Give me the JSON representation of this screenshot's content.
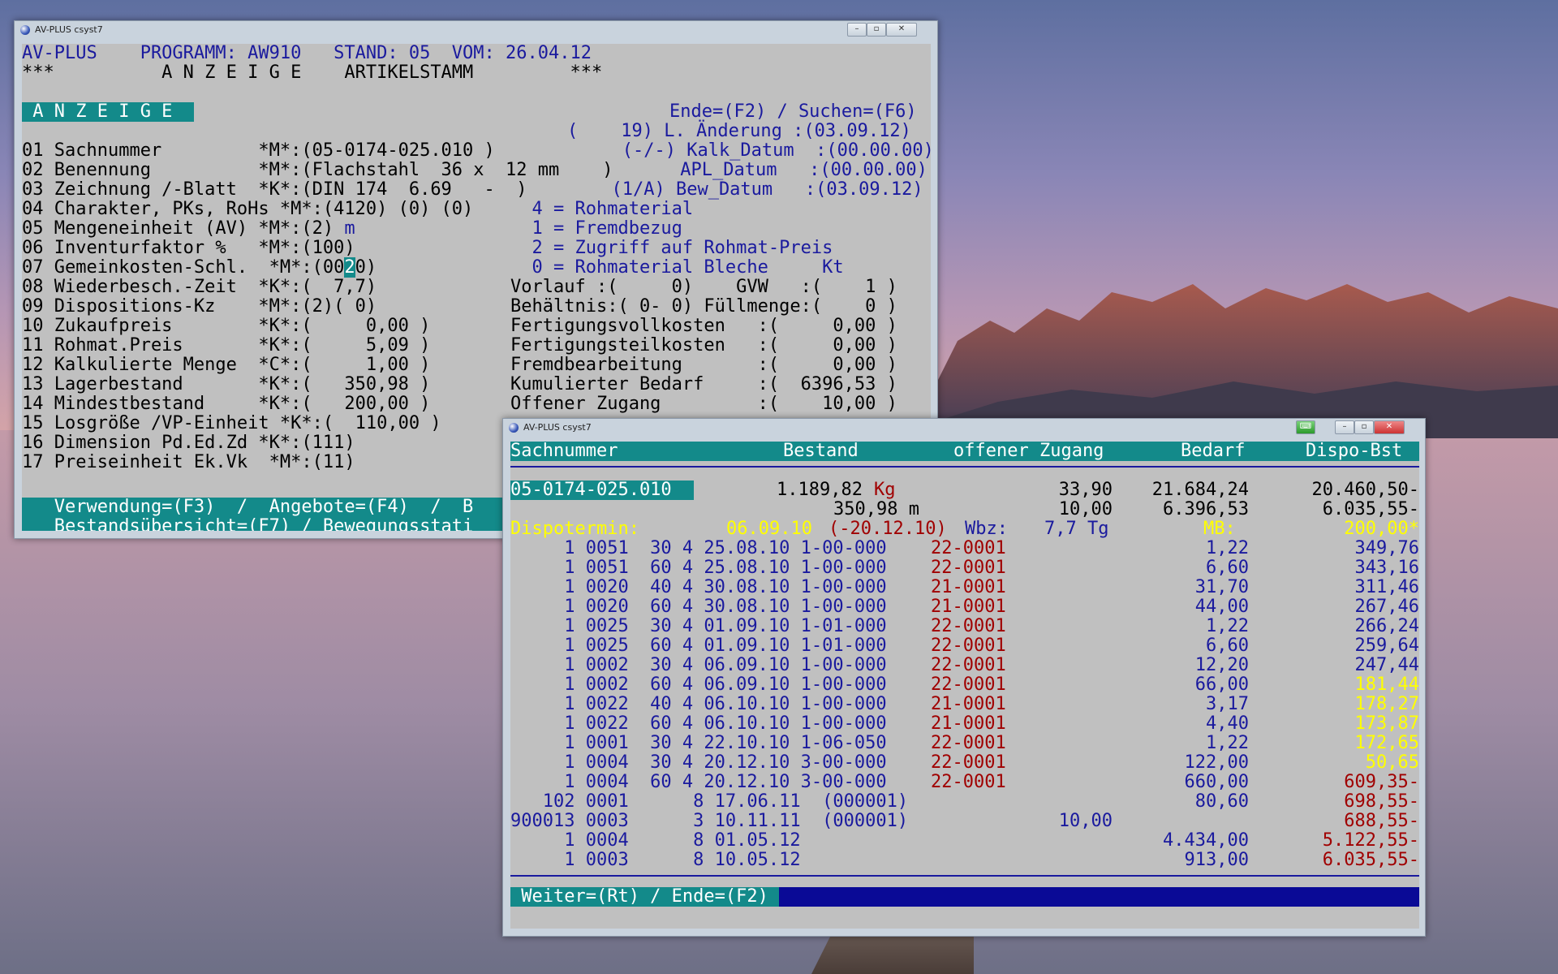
{
  "window1": {
    "title": "AV-PLUS csyst7",
    "header": [
      "AV-PLUS    PROGRAMM: AW910   STAND: 05  VOM: 26.04.12",
      "***          A N Z E I G E    ARTIKELSTAMM         ***"
    ],
    "mode_label": " A N Z E I G E ",
    "top_right": "Ende=(F2) / Suchen=(F6)",
    "lines": [
      {
        "left": "",
        "right": "(    19) L. Änderung :(03.09.12)"
      },
      {
        "left": "01 Sachnummer         *M*:(05-0174-025.010 )",
        "right": "   (-/-) Kalk_Datum  :(00.00.00)"
      },
      {
        "left": "02 Benennung          *M*:(Flachstahl  36 x  12 mm    )",
        "right": " APL_Datum   :(00.00.00)"
      },
      {
        "left": "03 Zeichnung /-Blatt  *K*:(DIN 174  6.69   -  )",
        "right": "  (1/A) Bew_Datum   :(03.09.12)"
      },
      {
        "left": "04 Charakter, PKs, RoHs *M*:(4120) (0) (0)",
        "right": "  4 = Rohmaterial"
      },
      {
        "left": "05 Mengeneinheit (AV) *M*:(2) ",
        "unit": "m",
        "right": "  1 = Fremdbezug"
      },
      {
        "left": "06 Inventurfaktor %   *M*:(100)",
        "right": "  2 = Zugriff auf Rohmat-Preis"
      },
      {
        "left": "07 Gemeinkosten-Schl.  *M*:(00",
        "cursor": "2",
        "left2": "0)",
        "right": "  0 = Rohmaterial Bleche     Kt"
      },
      {
        "left": "08 Wiederbesch.-Zeit  *K*:(  7,7)",
        "right": "Vorlauf :(     0)    GVW   :(    1 )"
      },
      {
        "left": "09 Dispositions-Kz    *M*:(2)( 0)",
        "right": "Behältnis:( 0- 0) Füllmenge:(    0 )"
      },
      {
        "left": "10 Zukaufpreis        *K*:(     0,00 )",
        "right": "Fertigungsvollkosten   :(     0,00 )"
      },
      {
        "left": "11 Rohmat.Preis       *K*:(     5,09 )",
        "right": "Fertigungsteilkosten   :(     0,00 )"
      },
      {
        "left": "12 Kalkulierte Menge  *C*:(     1,00 )",
        "right": "Fremdbearbeitung       :(     0,00 )"
      },
      {
        "left": "13 Lagerbestand       *K*:(   350,98 )",
        "right": "Kumulierter Bedarf     :(  6396,53 )"
      },
      {
        "left": "14 Mindestbestand     *K*:(   200,00 )",
        "right": "Offener Zugang         :(    10,00 )"
      },
      {
        "left": "15 Losgröße /VP-Einheit *K*:(  110,00 )",
        "right": ""
      },
      {
        "left": "16 Dimension Pd.Ed.Zd *K*:(111)",
        "right": ""
      },
      {
        "left": "17 Preiseinheit Ek.Vk  *M*:(11)",
        "right": ""
      }
    ],
    "footer1": "   Verwendung=(F3)  /  Angebote=(F4)  /  B",
    "footer2": "   Bestandsübersicht=(F7) / Bewegungsstati"
  },
  "window2": {
    "title": "AV-PLUS csyst7",
    "columns": [
      "Sachnummer",
      "Bestand",
      "offener Zugang",
      "Bedarf",
      "Dispo-Bst"
    ],
    "item": {
      "id": "05-0174-025.010",
      "bestand1": "1.189,82",
      "unit1": "Kg",
      "zugang1": "33,90",
      "bedarf1": "21.684,24",
      "dispo1": "20.460,50-",
      "bestand2": "350,98 m",
      "zugang2": "10,00",
      "bedarf2": "6.396,53",
      "dispo2": "6.035,55-"
    },
    "dispo": {
      "label": "Dispotermin:",
      "date": "06.09.10",
      "date2": "(-20.12.10)",
      "wbz_label": "Wbz:",
      "wbz": "7,7 Tg",
      "mb_label": "MB:",
      "mb": "200,00*"
    },
    "rows": [
      {
        "a": "     1 0051  30 4 25.08.10 1-00-000",
        "b": "22-0001",
        "bedarf": "1,22",
        "dispo": "349,76",
        "dc": "navy"
      },
      {
        "a": "     1 0051  60 4 25.08.10 1-00-000",
        "b": "22-0001",
        "bedarf": "6,60",
        "dispo": "343,16",
        "dc": "navy"
      },
      {
        "a": "     1 0020  40 4 30.08.10 1-00-000",
        "b": "21-0001",
        "bedarf": "31,70",
        "dispo": "311,46",
        "dc": "navy"
      },
      {
        "a": "     1 0020  60 4 30.08.10 1-00-000",
        "b": "21-0001",
        "bedarf": "44,00",
        "dispo": "267,46",
        "dc": "navy"
      },
      {
        "a": "     1 0025  30 4 01.09.10 1-01-000",
        "b": "22-0001",
        "bedarf": "1,22",
        "dispo": "266,24",
        "dc": "navy"
      },
      {
        "a": "     1 0025  60 4 01.09.10 1-01-000",
        "b": "22-0001",
        "bedarf": "6,60",
        "dispo": "259,64",
        "dc": "navy"
      },
      {
        "a": "     1 0002  30 4 06.09.10 1-00-000",
        "b": "22-0001",
        "bedarf": "12,20",
        "dispo": "247,44",
        "dc": "navy"
      },
      {
        "a": "     1 0002  60 4 06.09.10 1-00-000",
        "b": "22-0001",
        "bedarf": "66,00",
        "dispo": "181,44",
        "dc": "yel"
      },
      {
        "a": "     1 0022  40 4 06.10.10 1-00-000",
        "b": "21-0001",
        "bedarf": "3,17",
        "dispo": "178,27",
        "dc": "yel"
      },
      {
        "a": "     1 0022  60 4 06.10.10 1-00-000",
        "b": "21-0001",
        "bedarf": "4,40",
        "dispo": "173,87",
        "dc": "yel"
      },
      {
        "a": "     1 0001  30 4 22.10.10 1-06-050",
        "b": "22-0001",
        "bedarf": "1,22",
        "dispo": "172,65",
        "dc": "yel"
      },
      {
        "a": "     1 0004  30 4 20.12.10 3-00-000",
        "b": "22-0001",
        "bedarf": "122,00",
        "dispo": "50,65",
        "dc": "yel"
      },
      {
        "a": "     1 0004  60 4 20.12.10 3-00-000",
        "b": "22-0001",
        "bedarf": "660,00",
        "dispo": "609,35-",
        "dc": "red"
      },
      {
        "a": "   102 0001      8 17.06.11  (000001)",
        "b": "",
        "zugang": "",
        "bedarf": "80,60",
        "dispo": "698,55-",
        "dc": "red"
      },
      {
        "a": "900013 0003      3 10.11.11  (000001)",
        "b": "",
        "zugang": "10,00",
        "bedarf": "",
        "dispo": "688,55-",
        "dc": "red"
      },
      {
        "a": "     1 0004      8 01.05.12",
        "b": "",
        "bedarf": "4.434,00",
        "dispo": "5.122,55-",
        "dc": "red"
      },
      {
        "a": "     1 0003      8 10.05.12",
        "b": "",
        "bedarf": "913,00",
        "dispo": "6.035,55-",
        "dc": "red"
      }
    ],
    "footer": " Weiter=(Rt) / Ende=(F2) "
  }
}
